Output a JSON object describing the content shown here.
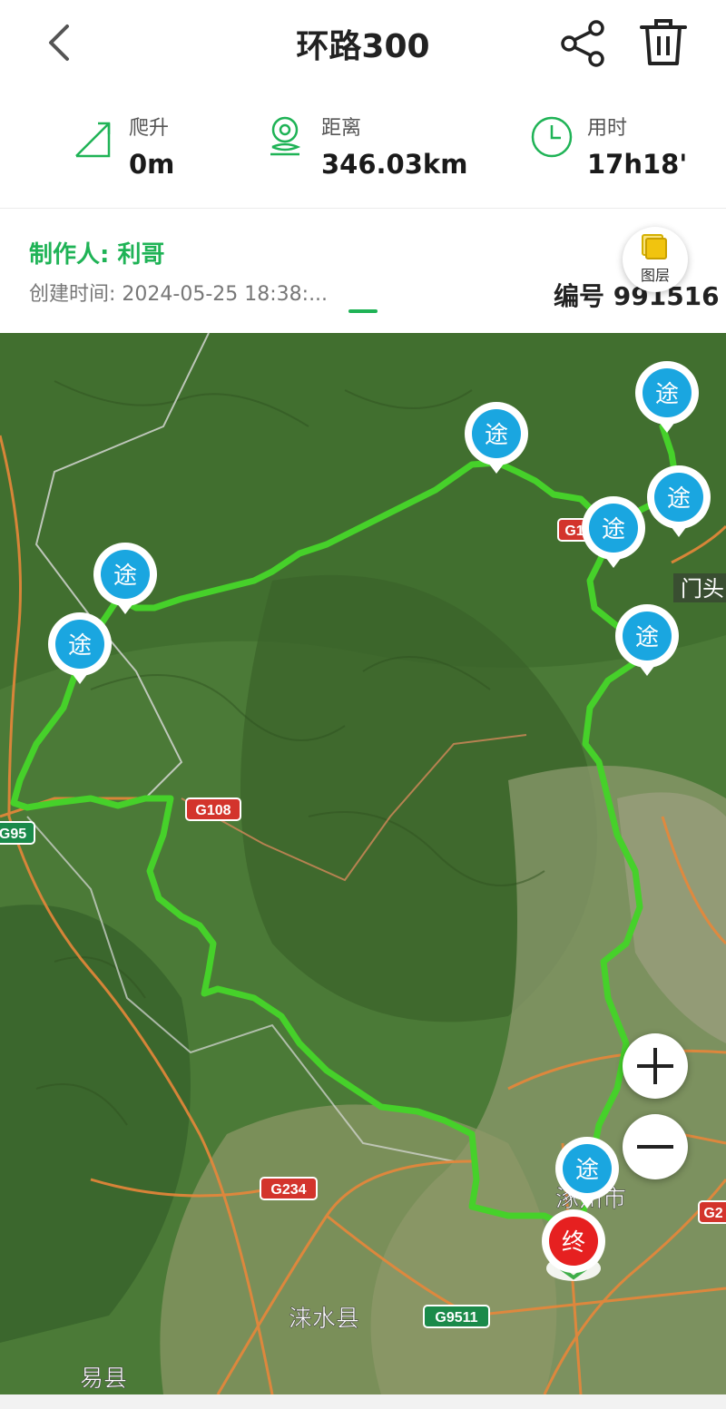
{
  "header": {
    "title": "环路300"
  },
  "stats": {
    "climb": {
      "label": "爬升",
      "value": "0m"
    },
    "distance": {
      "label": "距离",
      "value": "346.03km"
    },
    "duration": {
      "label": "用时",
      "value": "17h18'"
    }
  },
  "info": {
    "maker": "制作人: 利哥",
    "created": "创建时间: 2024-05-25 18:38:...",
    "code": "编号 991516",
    "layer_label": "图层"
  },
  "map": {
    "waypoint_label": "途",
    "end_label": "终",
    "road_labels": {
      "g108": "G108",
      "g95": "G95",
      "g234": "G234",
      "g9511": "G9511",
      "g1": "G1",
      "g2": "G2"
    },
    "place_labels": {
      "mentou": "门头",
      "laishui": "涞水县",
      "yixian": "易县",
      "zhuozhou": "涿州市"
    }
  },
  "colors": {
    "accent": "#1fb356",
    "route": "#4cd42a",
    "waypoint": "#1aa6e0",
    "end": "#e62020"
  }
}
